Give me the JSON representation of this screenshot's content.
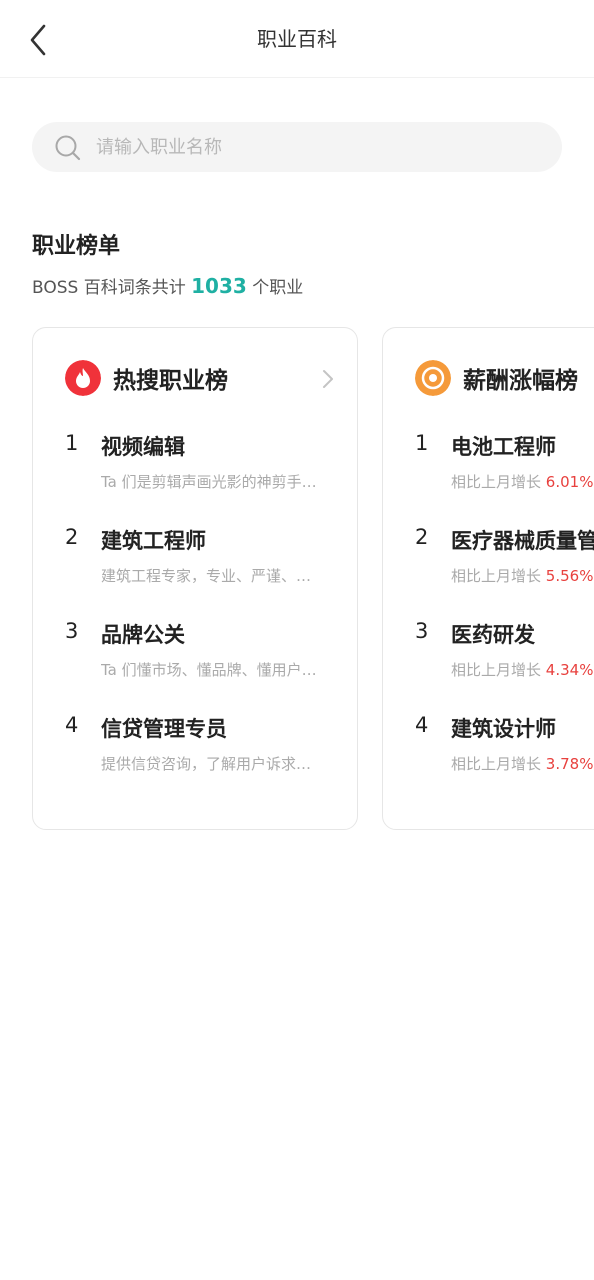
{
  "header": {
    "title": "职业百科"
  },
  "search": {
    "placeholder": "请输入职业名称",
    "value": ""
  },
  "section": {
    "title": "职业榜单",
    "subtitle_prefix": "BOSS 百科词条共计",
    "count": "1033",
    "subtitle_suffix": "个职业"
  },
  "hot_list": {
    "title": "热搜职业榜",
    "icon": "flame-icon",
    "icon_color": "#f0323a",
    "items": [
      {
        "rank": "1",
        "name": "视频编辑",
        "desc": "Ta 们是剪辑声画光影的神剪手…"
      },
      {
        "rank": "2",
        "name": "建筑工程师",
        "desc": "建筑工程专家，专业、严谨、…"
      },
      {
        "rank": "3",
        "name": "品牌公关",
        "desc": "Ta 们懂市场、懂品牌、懂用户…"
      },
      {
        "rank": "4",
        "name": "信贷管理专员",
        "desc": "提供信贷咨询，了解用户诉求…"
      }
    ]
  },
  "salary_list": {
    "title": "薪酬涨幅榜",
    "icon": "coin-icon",
    "icon_color": "#f59a3a",
    "growth_label": "相比上月增长",
    "items": [
      {
        "rank": "1",
        "name": "电池工程师",
        "growth": "6.01%"
      },
      {
        "rank": "2",
        "name": "医疗器械质量管",
        "growth": "5.56%"
      },
      {
        "rank": "3",
        "name": "医药研发",
        "growth": "4.34%"
      },
      {
        "rank": "4",
        "name": "建筑设计师",
        "growth": "3.78%"
      }
    ]
  },
  "colors": {
    "accent": "#1fb0a3",
    "growth": "#e8413e"
  }
}
